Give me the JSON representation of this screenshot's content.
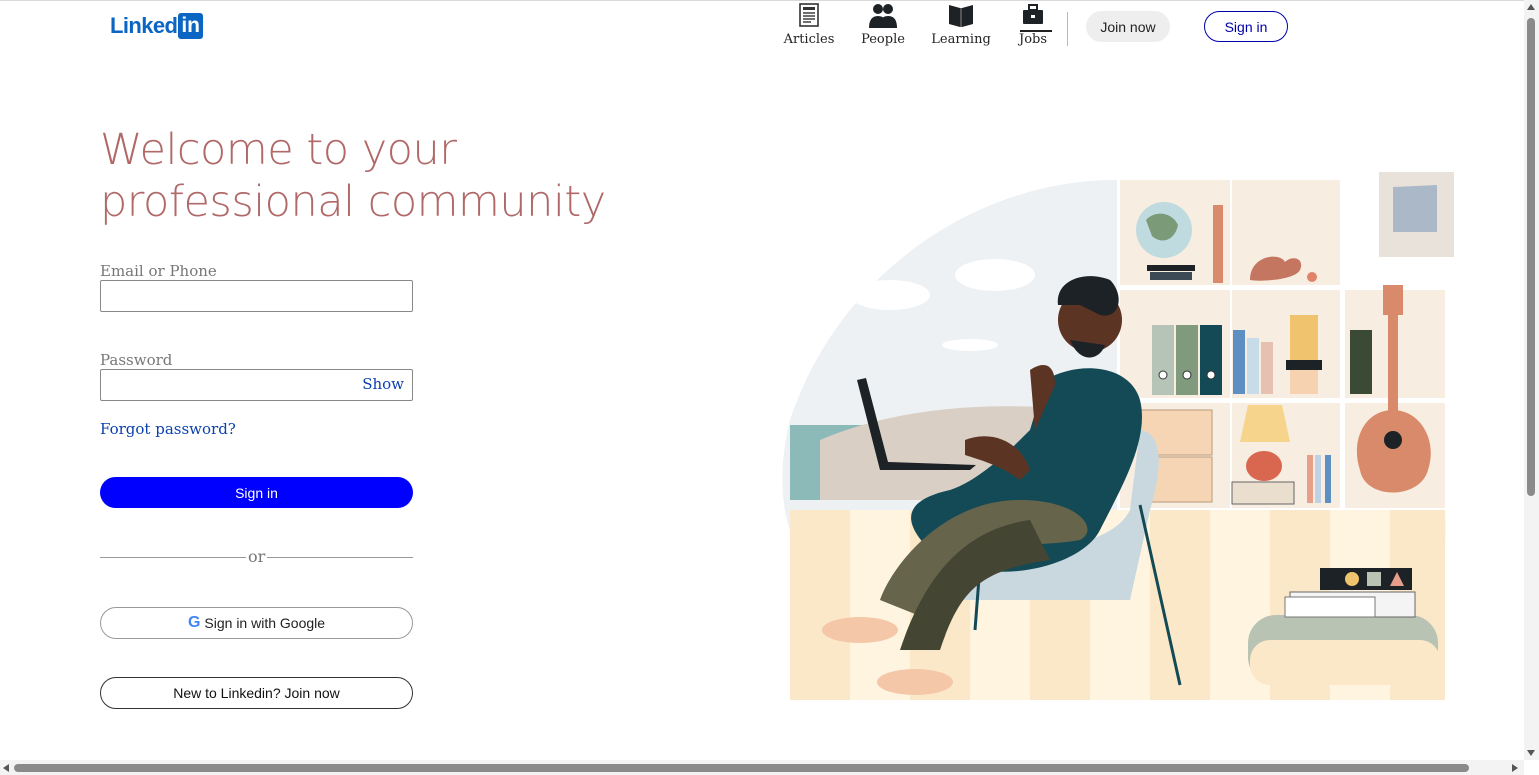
{
  "header": {
    "logo_text": "Linked",
    "logo_box": "in",
    "nav": [
      {
        "label": "Articles",
        "icon": "newspaper-icon"
      },
      {
        "label": "People",
        "icon": "people-icon"
      },
      {
        "label": "Learning",
        "icon": "book-icon"
      },
      {
        "label": "Jobs",
        "icon": "briefcase-icon"
      }
    ],
    "join_label": "Join now",
    "signin_label": "Sign in"
  },
  "hero": {
    "line1": "Welcome to your",
    "line2": "professional community"
  },
  "form": {
    "email_label": "Email or Phone",
    "email_value": "",
    "password_label": "Password",
    "password_value": "",
    "show_label": "Show",
    "forgot_label": "Forgot password?",
    "signin_label": "Sign in",
    "or_label": "or",
    "google_g": "G",
    "google_label": "Sign in with Google",
    "new_label": "New to Linkedin? Join now"
  },
  "colors": {
    "brand": "#0a66c2",
    "headline": "#b06868",
    "primary_button": "#0000ff",
    "link": "#0a3fae"
  }
}
